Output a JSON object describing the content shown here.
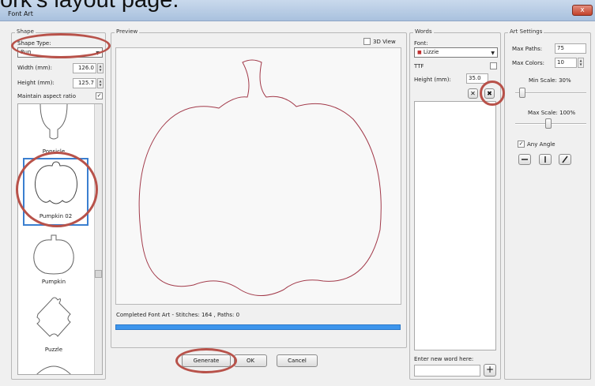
{
  "window": {
    "title": "Font Art",
    "close_glyph": "x"
  },
  "caption_overlay": "ork's layout page.",
  "shape_panel": {
    "group_label": "Shape",
    "shape_type_label": "Shape Type:",
    "shape_type_value": "Run",
    "width_label": "Width (mm):",
    "width_value": "126.0",
    "height_label": "Height (mm):",
    "height_value": "125.7",
    "aspect_label": "Maintain aspect ratio",
    "aspect_checked": "✓",
    "items": [
      {
        "name": "Popsicle"
      },
      {
        "name": "Pumpkin 02"
      },
      {
        "name": "Pumpkin"
      },
      {
        "name": "Puzzle"
      }
    ]
  },
  "preview_panel": {
    "group_label": "Preview",
    "view3d_label": "3D View",
    "status_text": "Completed Font Art - Stitches: 164 , Paths: 0",
    "progress_fraction": 1.0
  },
  "buttons": {
    "generate": "Generate",
    "ok": "OK",
    "cancel": "Cancel"
  },
  "words_panel": {
    "group_label": "Words",
    "font_label": "Font:",
    "font_value": "Lizzie",
    "ttf_label": "TTF",
    "height_label": "Height (mm):",
    "height_value": "35.0",
    "new_word_label": "Enter new word here:",
    "add_glyph": "+",
    "delete_glyph": "✕",
    "clear_glyph": "✖"
  },
  "art_settings": {
    "group_label": "Art Settings",
    "max_paths_label": "Max Paths:",
    "max_paths_value": "75",
    "max_colors_label": "Max Colors:",
    "max_colors_value": "10",
    "min_scale_label": "Min Scale: 30%",
    "min_scale_fraction": 0.3,
    "max_scale_label": "Max Scale: 100%",
    "max_scale_fraction": 1.0,
    "any_angle_label": "Any Angle",
    "any_angle_checked": "✓"
  },
  "colors": {
    "accent": "#3d95ec",
    "highlight": "#b8524a",
    "outline": "#a23a4a",
    "selected_border": "#3b7fd0"
  }
}
